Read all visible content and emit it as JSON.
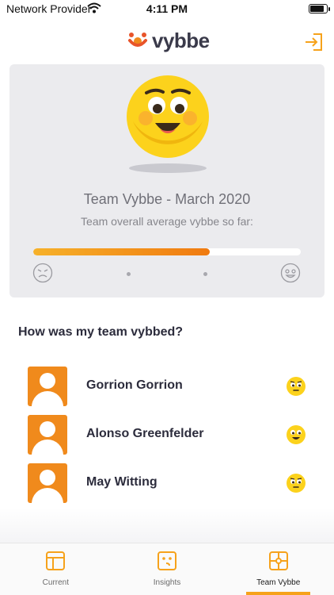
{
  "status_bar": {
    "carrier": "Network Provider",
    "time": "4:11 PM",
    "battery_level": 0.9
  },
  "header": {
    "logo_text": "vybbe",
    "logout_icon": "logout-icon"
  },
  "summary": {
    "title": "Team Vybbe - March 2020",
    "subtitle": "Team overall average vybbe so far:",
    "average_level": 0.66,
    "low_icon": "angry-face-icon",
    "high_icon": "happy-face-icon"
  },
  "team": {
    "title": "How was my team vybbed?",
    "members": [
      {
        "name": "Gorrion Gorrion",
        "mood_icon": "neutral-face-icon"
      },
      {
        "name": "Alonso Greenfelder",
        "mood_icon": "smile-face-icon"
      },
      {
        "name": "May Witting",
        "mood_icon": "neutral-face-icon"
      }
    ]
  },
  "tabs": [
    {
      "label": "Current",
      "icon": "current-icon",
      "active": false
    },
    {
      "label": "Insights",
      "icon": "insights-icon",
      "active": false
    },
    {
      "label": "Team Vybbe",
      "icon": "team-vybbe-icon",
      "active": true
    }
  ],
  "colors": {
    "accent": "#f6a21b",
    "avatar": "#f08a1c",
    "emoji": "#fcd21c"
  }
}
